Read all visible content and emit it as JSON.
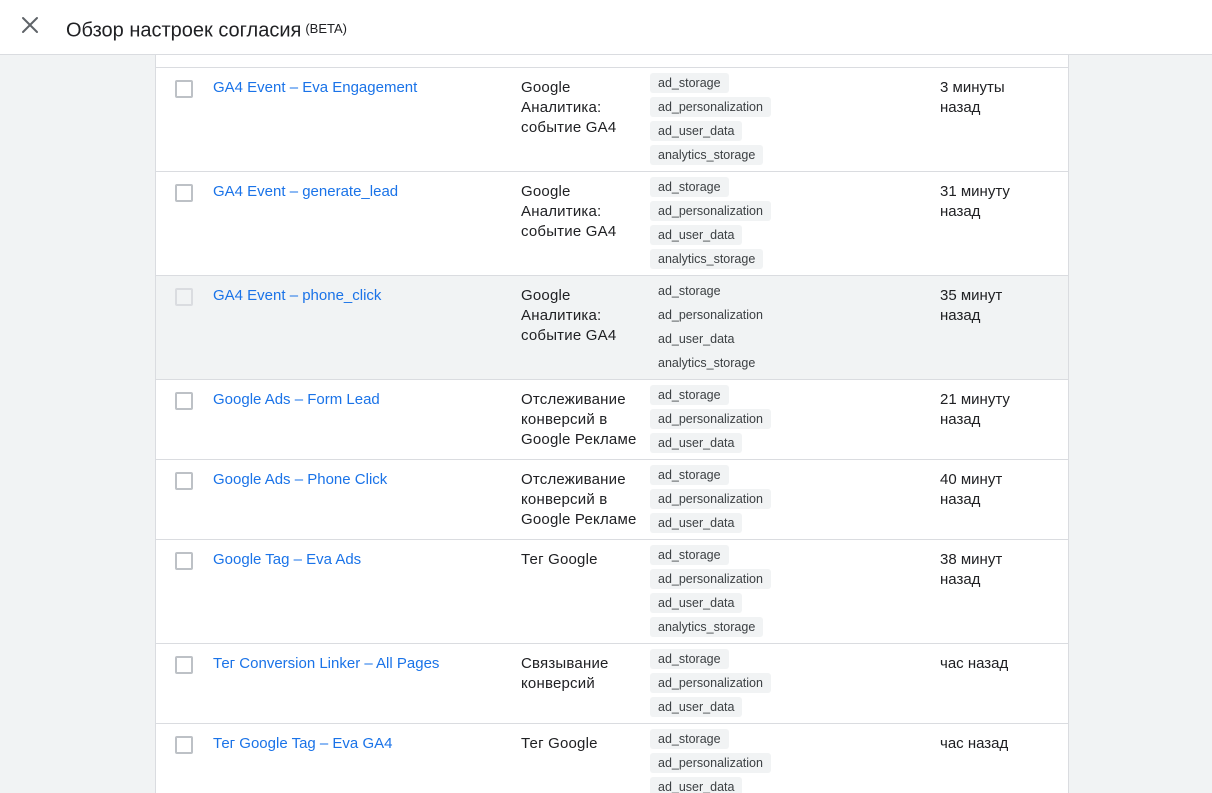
{
  "header": {
    "title": "Обзор настроек согласия",
    "badge": "(BETA)"
  },
  "rows": [
    {
      "name": "GA4 Event – Eva Engagement",
      "type": "Google Аналитика: событие GA4",
      "consent": [
        "ad_storage",
        "ad_personalization",
        "ad_user_data",
        "analytics_storage"
      ],
      "time": "3 минуты назад"
    },
    {
      "name": "GA4 Event – generate_lead",
      "type": "Google Аналитика: событие GA4",
      "consent": [
        "ad_storage",
        "ad_personalization",
        "ad_user_data",
        "analytics_storage"
      ],
      "time": "31 минуту назад"
    },
    {
      "name": "GA4 Event – phone_click",
      "type": "Google Аналитика: событие GA4",
      "consent": [
        "ad_storage",
        "ad_personalization",
        "ad_user_data",
        "analytics_storage"
      ],
      "time": "35 минут назад"
    },
    {
      "name": "Google Ads – Form Lead",
      "type": "Отслеживание конверсий в Google Рекламе",
      "consent": [
        "ad_storage",
        "ad_personalization",
        "ad_user_data"
      ],
      "time": "21 минуту назад"
    },
    {
      "name": "Google Ads – Phone Click",
      "type": "Отслеживание конверсий в Google Рекламе",
      "consent": [
        "ad_storage",
        "ad_personalization",
        "ad_user_data"
      ],
      "time": "40 минут назад"
    },
    {
      "name": "Google Tag – Eva Ads",
      "type": "Тег Google",
      "consent": [
        "ad_storage",
        "ad_personalization",
        "ad_user_data",
        "analytics_storage"
      ],
      "time": "38 минут назад"
    },
    {
      "name": "Тег Conversion Linker – All Pages",
      "type": "Связывание конверсий",
      "consent": [
        "ad_storage",
        "ad_personalization",
        "ad_user_data"
      ],
      "time": "час назад"
    },
    {
      "name": "Тег Google Tag – Eva GA4",
      "type": "Тег Google",
      "consent": [
        "ad_storage",
        "ad_personalization",
        "ad_user_data"
      ],
      "time": "час назад"
    }
  ],
  "colors": {
    "link": "#1a73e8",
    "divider": "#dadce0",
    "chip_bg": "#f1f3f4",
    "page_bg": "#f1f3f4"
  },
  "icons": {
    "close": "close-icon"
  }
}
